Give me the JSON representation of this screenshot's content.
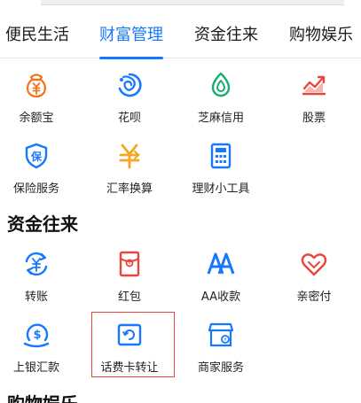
{
  "tabs": [
    {
      "label": "便民生活",
      "active": false
    },
    {
      "label": "财富管理",
      "active": true
    },
    {
      "label": "资金往来",
      "active": false
    },
    {
      "label": "购物娱乐",
      "active": false
    }
  ],
  "wealth": {
    "items": [
      {
        "label": "余额宝",
        "icon": "yuebao-icon"
      },
      {
        "label": "花呗",
        "icon": "huabei-icon"
      },
      {
        "label": "芝麻信用",
        "icon": "sesame-credit-icon"
      },
      {
        "label": "股票",
        "icon": "stock-chart-icon"
      },
      {
        "label": "保险服务",
        "icon": "insurance-shield-icon"
      },
      {
        "label": "汇率换算",
        "icon": "exchange-rate-icon"
      },
      {
        "label": "理财小工具",
        "icon": "calculator-icon"
      }
    ]
  },
  "funds": {
    "title": "资金往来",
    "items": [
      {
        "label": "转账",
        "icon": "transfer-icon"
      },
      {
        "label": "红包",
        "icon": "red-envelope-icon"
      },
      {
        "label": "AA收款",
        "icon": "aa-collect-icon"
      },
      {
        "label": "亲密付",
        "icon": "intimate-pay-heart-icon"
      },
      {
        "label": "上银汇款",
        "icon": "remittance-icon"
      },
      {
        "label": "话费卡转让",
        "icon": "phone-card-transfer-icon"
      },
      {
        "label": "商家服务",
        "icon": "merchant-service-icon"
      }
    ]
  },
  "shopping": {
    "title": "购物娱乐"
  },
  "colors": {
    "accent": "#1677ff",
    "icon_blue": "#1677ff",
    "icon_orange": "#f5721d",
    "icon_red": "#e8453c",
    "icon_green": "#1aad6e",
    "highlight": "#e8453c"
  }
}
